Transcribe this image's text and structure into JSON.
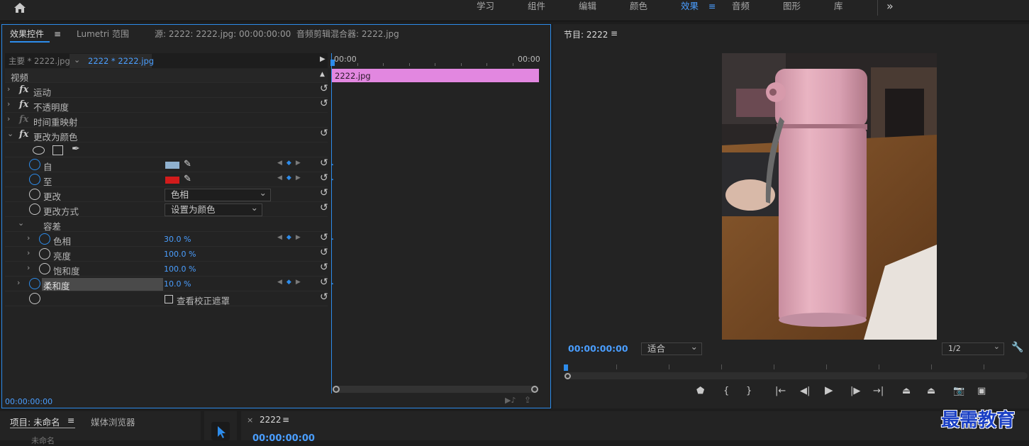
{
  "topbar": {
    "home_icon": "home-icon",
    "workspaces": [
      "学习",
      "组件",
      "编辑",
      "颜色",
      "效果",
      "音频",
      "图形",
      "库"
    ],
    "active_workspace": "效果",
    "more": "»"
  },
  "effect_panel": {
    "tabs": [
      "效果控件",
      "Lumetri 范围",
      "源: 2222: 2222.jpg: 00:00:00:00",
      "音频剪辑混合器: 2222.jpg"
    ],
    "menu_icon": "≡",
    "master_label": "主要 * 2222.jpg",
    "clip_label": "2222 * 2222.jpg",
    "section_video": "视频",
    "effects": {
      "motion": "运动",
      "opacity": "不透明度",
      "time_remap": "时间重映射",
      "change_to_color": "更改为颜色"
    },
    "fx_label": "fx",
    "params": {
      "from_label": "自",
      "from_color": "#8fb1cf",
      "to_label": "至",
      "to_color": "#d21b1b",
      "change_label": "更改",
      "change_value": "色相",
      "change_by_label": "更改方式",
      "change_by_value": "设置为颜色",
      "tolerance_label": "容差",
      "hue_label": "色相",
      "hue_value": "30.0 %",
      "lightness_label": "亮度",
      "lightness_value": "100.0 %",
      "saturation_label": "饱和度",
      "saturation_value": "100.0 %",
      "softness_label": "柔和度",
      "softness_value": "10.0 %",
      "view_matte_label": "查看校正遮罩"
    },
    "timeline": {
      "start_time": "00:00",
      "end_time": "00:00",
      "clip_name": "2222.jpg",
      "clip_color": "#e287e0"
    },
    "timecode": "00:00:00:00"
  },
  "program_panel": {
    "title": "节目: 2222",
    "timecode": "00:00:00:00",
    "fit": "适合",
    "resolution": "1/2"
  },
  "bottom": {
    "project_tab": "项目: 未命名",
    "media_browser_tab": "媒体浏览器",
    "sequence_tab": "2222",
    "sequence_timecode": "00:00:00:00",
    "project_item": "未命名"
  },
  "watermark": "最需教育"
}
